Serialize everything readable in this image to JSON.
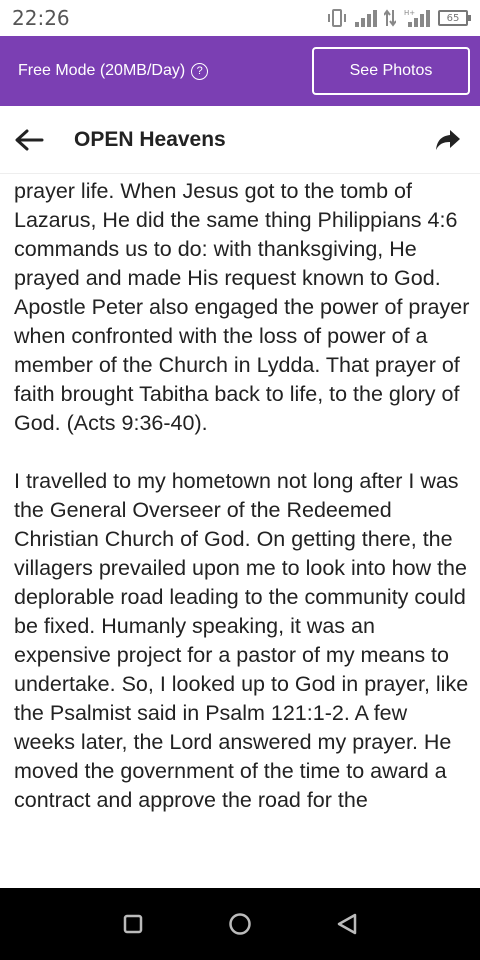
{
  "status_bar": {
    "time": "22:26",
    "battery": "65"
  },
  "banner": {
    "mode_label": "Free Mode (20MB/Day)",
    "see_photos_label": "See Photos"
  },
  "header": {
    "title": "OPEN Heavens"
  },
  "article": {
    "paragraph_1": "then every Christian must have an effective prayer life. When Jesus got to the tomb of Lazarus, He did the same thing Philippians 4:6 commands us to do: with thanksgiving, He prayed and made His request known to God. Apostle Peter also engaged the power of prayer when confronted with the loss of power of a member of the Church in Lydda. That prayer of faith brought Tabitha back to life, to the glory of God. (Acts 9:36-40).",
    "paragraph_2": "I travelled to my hometown not long after I was the General Overseer of the Redeemed Christian Church of God. On getting there, the villagers prevailed upon me to look into how the deplorable road leading to the community could be fixed. Humanly speaking, it was an expensive project for a pastor of my means to undertake. So, I looked up to God in prayer, like the Psalmist said in Psalm 121:1-2. A few weeks later, the Lord answered my prayer. He moved the government of the time to award a contract and approve the road for the"
  },
  "colors": {
    "banner": "#7b3fb3",
    "nav_bar": "#000000"
  },
  "icons": {
    "back": "arrow-left-icon",
    "share": "share-arrow-icon",
    "help": "question-circle-icon",
    "nav_recent": "square-icon",
    "nav_home": "circle-icon",
    "nav_back": "triangle-back-icon"
  }
}
